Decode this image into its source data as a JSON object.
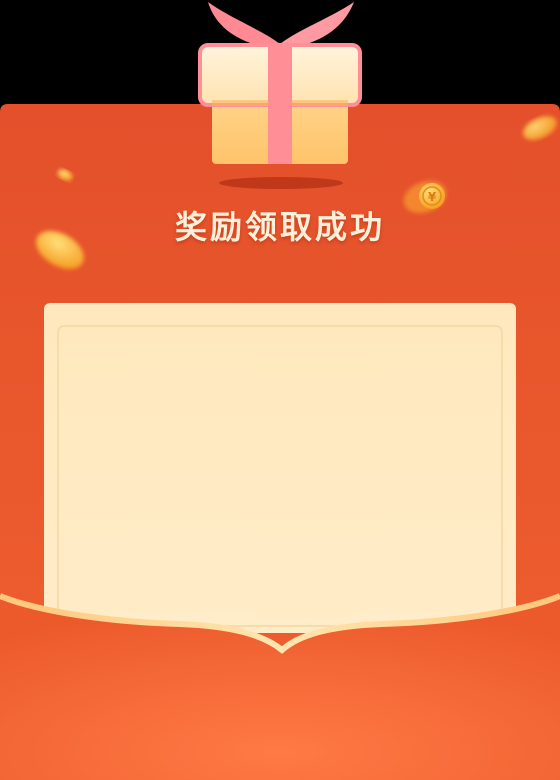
{
  "dialog": {
    "title": "奖励领取成功"
  },
  "colors": {
    "red_main": "#E65530",
    "red_dark": "#D94222",
    "cream_panel": "#FFEBC2",
    "gold": "#FFB84D",
    "ribbon_pink": "#FF8C95"
  },
  "icons": {
    "gift": "gift-box-icon",
    "coin": "yuan-coin-icon"
  }
}
